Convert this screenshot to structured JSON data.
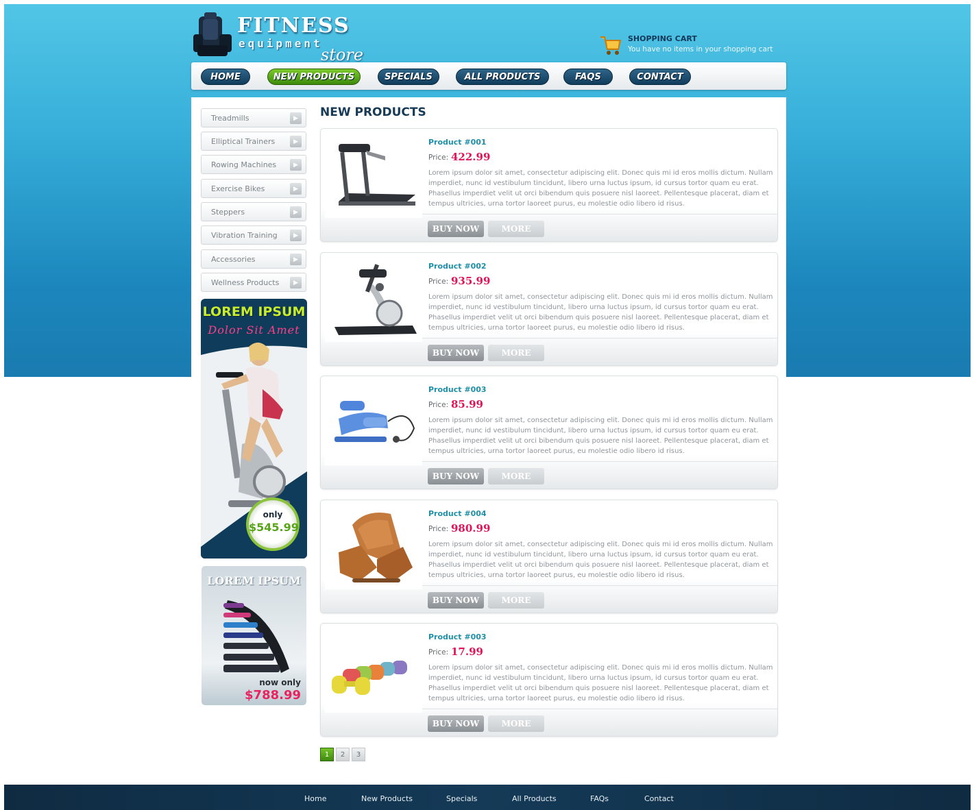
{
  "brand": {
    "title": "FITNESS",
    "subtitle": "equipment",
    "script": "store"
  },
  "cart": {
    "title": "SHOPPING CART",
    "status": "You have no items in your shopping cart"
  },
  "nav": {
    "items": [
      "HOME",
      "NEW PRODUCTS",
      "SPECIALS",
      "ALL PRODUCTS",
      "FAQS",
      "CONTACT"
    ],
    "active": "NEW PRODUCTS",
    "active_color": "#5aa81b",
    "color": "#1b4a6c"
  },
  "sidebar": {
    "categories": [
      "Treadmills",
      "Elliptical Trainers",
      "Rowing Machines",
      "Exercise Bikes",
      "Steppers",
      "Vibration Training",
      "Accessories",
      "Wellness Products"
    ],
    "arrow": "▶"
  },
  "promo1": {
    "title": "LOREM IPSUM",
    "subtitle": "Dolor Sit Amet",
    "badge_only": "only",
    "price": "$545.99"
  },
  "promo2": {
    "title": "LOREM IPSUM",
    "now_only": "now only",
    "price": "$788.99"
  },
  "main": {
    "heading": "NEW PRODUCTS",
    "price_label": "Price:",
    "buy_label": "BUY NOW",
    "more_label": "MORE",
    "description": "Lorem ipsum dolor sit amet, consectetur adipiscing elit. Donec quis mi id eros mollis dictum. Nullam imperdiet, nunc id vestibulum tincidunt, libero urna luctus ipsum, id cursus tortor quam eu erat. Phasellus imperdiet velit ut orci bibendum quis posuere nisl laoreet. Pellentesque placerat, diam et tempus ultricies, urna tortor laoreet purus, eu molestie odio libero id risus.",
    "products": [
      {
        "name": "Product #001",
        "price": "422.99",
        "image": "treadmill"
      },
      {
        "name": "Product #002",
        "price": "935.99",
        "image": "elliptical-trainer"
      },
      {
        "name": "Product #003",
        "price": "85.99",
        "image": "stepper"
      },
      {
        "name": "Product #004",
        "price": "980.99",
        "image": "massage-chair"
      },
      {
        "name": "Product #003",
        "price": "17.99",
        "image": "dumbbells"
      }
    ]
  },
  "pagination": {
    "pages": [
      "1",
      "2",
      "3"
    ],
    "current": "1"
  },
  "footer": {
    "links": [
      "Home",
      "New Products",
      "Specials",
      "All Products",
      "FAQs",
      "Contact"
    ]
  },
  "colors": {
    "sky_top": "#52c6e6",
    "sky_bottom": "#1a7bb0",
    "price": "#e1145a",
    "product_name": "#1e8fa8",
    "footer": "#0f2b42"
  }
}
